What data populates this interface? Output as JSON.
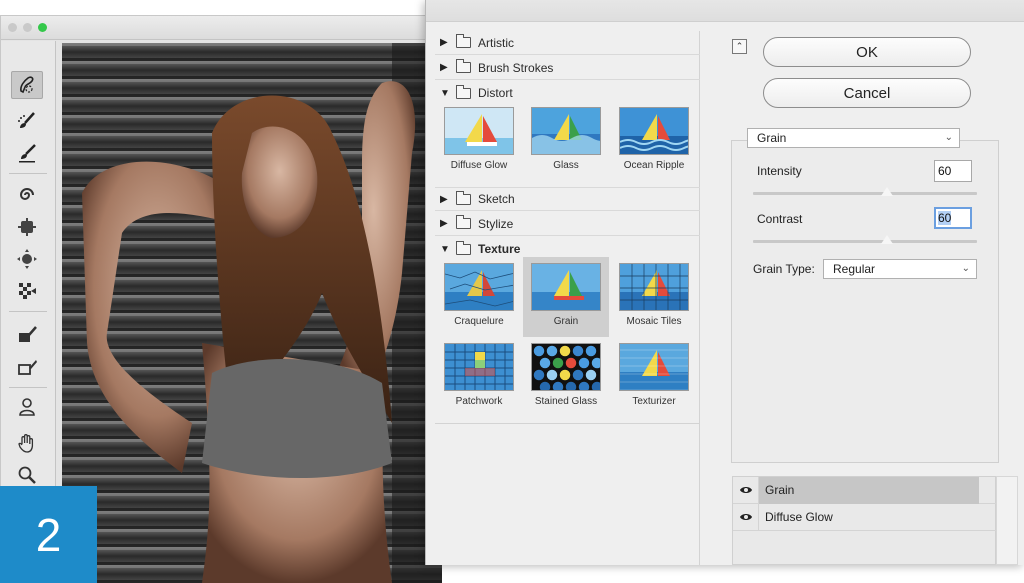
{
  "badge": {
    "number": "2"
  },
  "filter_gallery": {
    "categories": [
      {
        "label": "Artistic",
        "expanded": false
      },
      {
        "label": "Brush Strokes",
        "expanded": false
      },
      {
        "label": "Distort",
        "expanded": true,
        "filters": [
          "Diffuse Glow",
          "Glass",
          "Ocean Ripple"
        ]
      },
      {
        "label": "Sketch",
        "expanded": false
      },
      {
        "label": "Stylize",
        "expanded": false
      },
      {
        "label": "Texture",
        "expanded": true,
        "filters": [
          "Craquelure",
          "Grain",
          "Mosaic Tiles",
          "Patchwork",
          "Stained Glass",
          "Texturizer"
        ]
      }
    ],
    "selected_filter": "Grain",
    "ok_label": "OK",
    "cancel_label": "Cancel",
    "filter_select_value": "Grain",
    "settings": {
      "intensity_label": "Intensity",
      "intensity_value": "60",
      "intensity_fraction": 0.6,
      "contrast_label": "Contrast",
      "contrast_value": "60",
      "contrast_fraction": 0.6,
      "grain_type_label": "Grain Type:",
      "grain_type_value": "Regular"
    },
    "layers": [
      {
        "name": "Grain",
        "selected": true
      },
      {
        "name": "Diffuse Glow",
        "selected": false
      }
    ]
  },
  "colors": {
    "badge": "#1e8bc9",
    "selection_highlight": "#b3d0f5",
    "traffic_green": "#34c84a"
  },
  "icons": [
    "quick-selection-brush-icon",
    "brush-icon",
    "brush-dots-icon",
    "twirl-icon",
    "pucker-icon",
    "bloat-icon",
    "reconstruct-icon",
    "mask-brush-icon",
    "eraser-brush-icon",
    "stamp-icon",
    "hand-icon",
    "zoom-icon",
    "eye-icon",
    "collapse-icon",
    "folder-icon",
    "disclosure-triangle-icon"
  ]
}
